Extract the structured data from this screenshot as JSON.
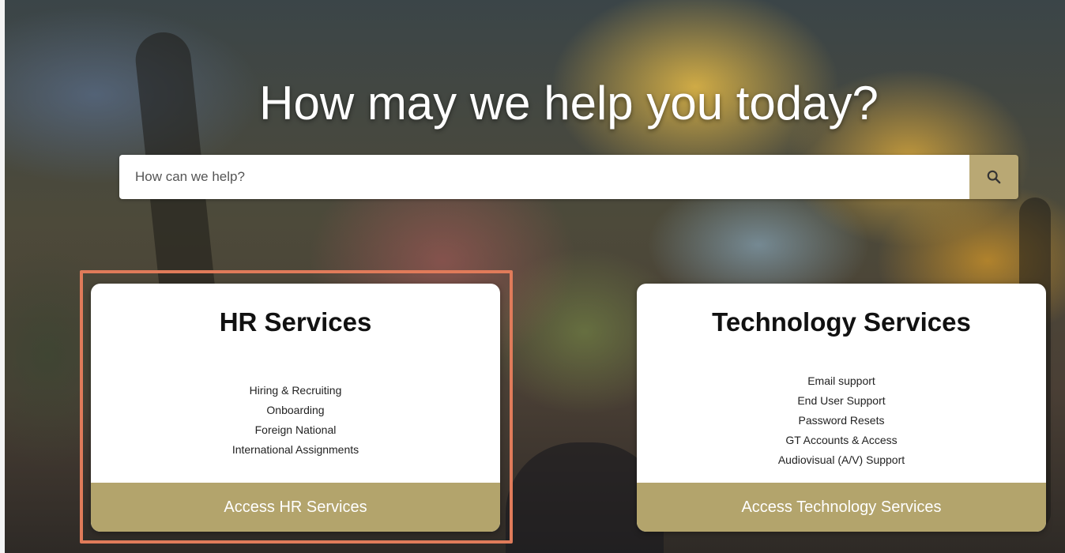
{
  "hero": {
    "headline": "How may we help you today?"
  },
  "search": {
    "placeholder": "How can we help?",
    "button_icon": "search-icon"
  },
  "cards": [
    {
      "title": "HR Services",
      "items": [
        "Hiring & Recruiting",
        "Onboarding",
        "Foreign National",
        "International Assignments"
      ],
      "action_label": "Access HR Services"
    },
    {
      "title": "Technology Services",
      "items": [
        "Email support",
        "End User Support",
        "Password Resets",
        "GT Accounts & Access",
        "Audiovisual (A/V) Support"
      ],
      "action_label": "Access Technology Services"
    }
  ],
  "colors": {
    "accent_gold": "#b3a46c",
    "highlight": "#e07b5a"
  }
}
